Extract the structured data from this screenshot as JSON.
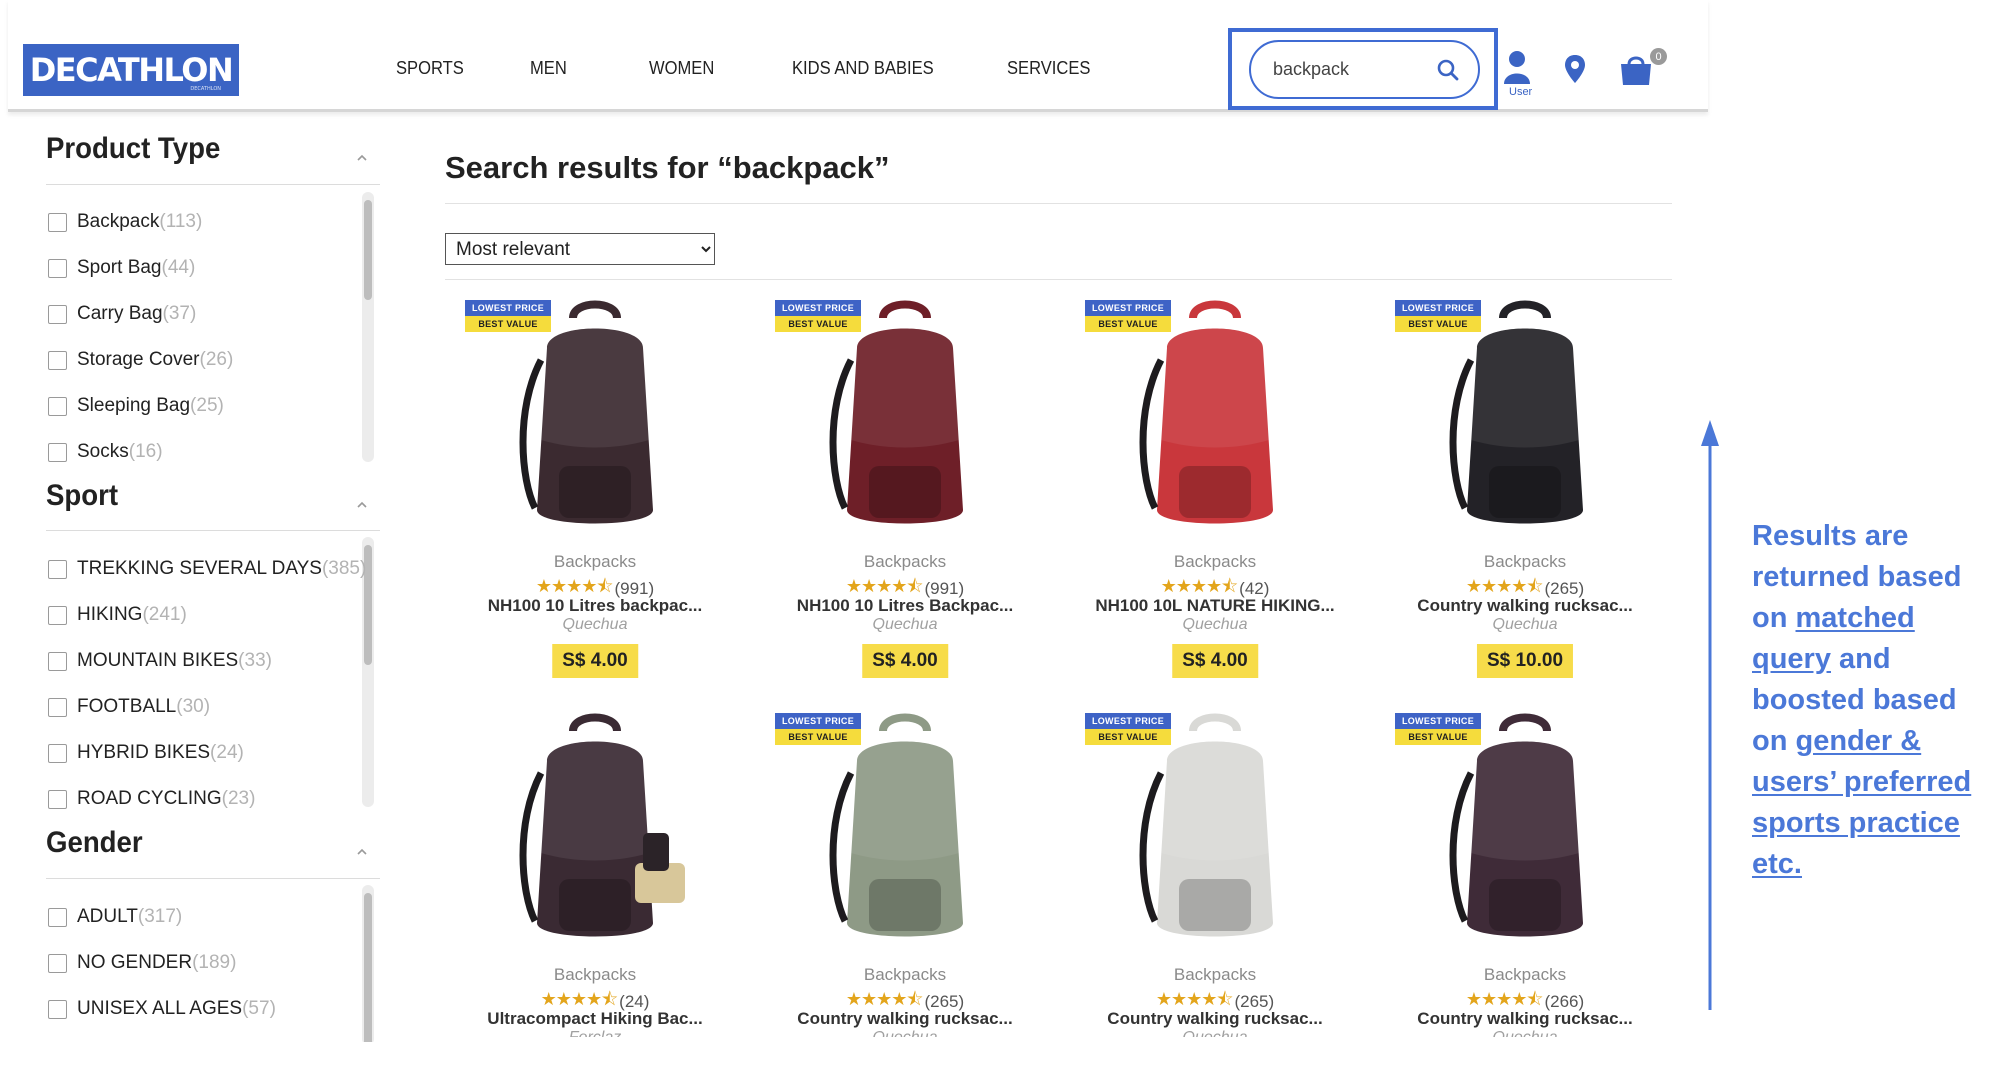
{
  "header": {
    "logo": "DECATHLON",
    "logo_tagline": "DECATHLON",
    "nav": [
      "SPORTS",
      "MEN",
      "WOMEN",
      "KIDS AND BABIES",
      "SERVICES"
    ],
    "search_value": "backpack",
    "user_label": "User",
    "cart_count": "0",
    "accent_color": "#3b64c4"
  },
  "sidebar": {
    "facets": [
      {
        "title": "Product Type",
        "items": [
          {
            "label": "Backpack",
            "count": "(113)"
          },
          {
            "label": "Sport Bag",
            "count": "(44)"
          },
          {
            "label": "Carry Bag",
            "count": "(37)"
          },
          {
            "label": "Storage Cover",
            "count": "(26)"
          },
          {
            "label": "Sleeping Bag",
            "count": "(25)"
          },
          {
            "label": "Socks",
            "count": "(16)"
          }
        ]
      },
      {
        "title": "Sport",
        "items": [
          {
            "label": "TREKKING SEVERAL DAYS",
            "count": "(385)"
          },
          {
            "label": "HIKING",
            "count": "(241)"
          },
          {
            "label": "MOUNTAIN BIKES",
            "count": "(33)"
          },
          {
            "label": "FOOTBALL",
            "count": "(30)"
          },
          {
            "label": "HYBRID BIKES",
            "count": "(24)"
          },
          {
            "label": "ROAD CYCLING",
            "count": "(23)"
          }
        ]
      },
      {
        "title": "Gender",
        "items": [
          {
            "label": "ADULT",
            "count": "(317)"
          },
          {
            "label": "NO GENDER",
            "count": "(189)"
          },
          {
            "label": "UNISEX ALL AGES",
            "count": "(57)"
          }
        ]
      }
    ]
  },
  "main": {
    "results_title": "Search results for “backpack”",
    "sort_selected": "Most relevant",
    "badge_line1": "LOWEST PRICE",
    "badge_line2": "BEST VALUE",
    "products": [
      {
        "category": "Backpacks",
        "stars": 4.5,
        "reviews": "(991)",
        "name": "NH100 10 Litres backpac...",
        "brand": "Quechua",
        "price": "S$ 4.00",
        "badge": true,
        "color": "#3b2a30"
      },
      {
        "category": "Backpacks",
        "stars": 4.5,
        "reviews": "(991)",
        "name": "NH100 10 Litres Backpac...",
        "brand": "Quechua",
        "price": "S$ 4.00",
        "badge": true,
        "color": "#6e1f28"
      },
      {
        "category": "Backpacks",
        "stars": 4.5,
        "reviews": "(42)",
        "name": "NH100 10L NATURE HIKING...",
        "brand": "Quechua",
        "price": "S$ 4.00",
        "badge": true,
        "color": "#c9373c"
      },
      {
        "category": "Backpacks",
        "stars": 4.5,
        "reviews": "(265)",
        "name": "Country walking rucksac...",
        "brand": "Quechua",
        "price": "S$ 10.00",
        "badge": true,
        "color": "#232227"
      },
      {
        "category": "Backpacks",
        "stars": 4.5,
        "reviews": "(24)",
        "name": "Ultracompact Hiking Bac...",
        "brand": "Forclaz",
        "price": "",
        "badge": false,
        "color": "#3a2a33"
      },
      {
        "category": "Backpacks",
        "stars": 4.5,
        "reviews": "(265)",
        "name": "Country walking rucksac...",
        "brand": "Quechua",
        "price": "",
        "badge": true,
        "color": "#8e9a86"
      },
      {
        "category": "Backpacks",
        "stars": 4.5,
        "reviews": "(265)",
        "name": "Country walking rucksac...",
        "brand": "Quechua",
        "price": "",
        "badge": true,
        "color": "#d9d9d6"
      },
      {
        "category": "Backpacks",
        "stars": 4.5,
        "reviews": "(266)",
        "name": "Country walking rucksac...",
        "brand": "Quechua",
        "price": "",
        "badge": true,
        "color": "#3f2b38"
      }
    ]
  },
  "annotation": {
    "parts": [
      {
        "text": "Results are returned based on ",
        "underline": false
      },
      {
        "text": "matched query",
        "underline": true
      },
      {
        "text": " and boosted based on ",
        "underline": false
      },
      {
        "text": "gender & users’ preferred sports practice etc.",
        "underline": true
      }
    ],
    "color": "#4b78d8"
  }
}
